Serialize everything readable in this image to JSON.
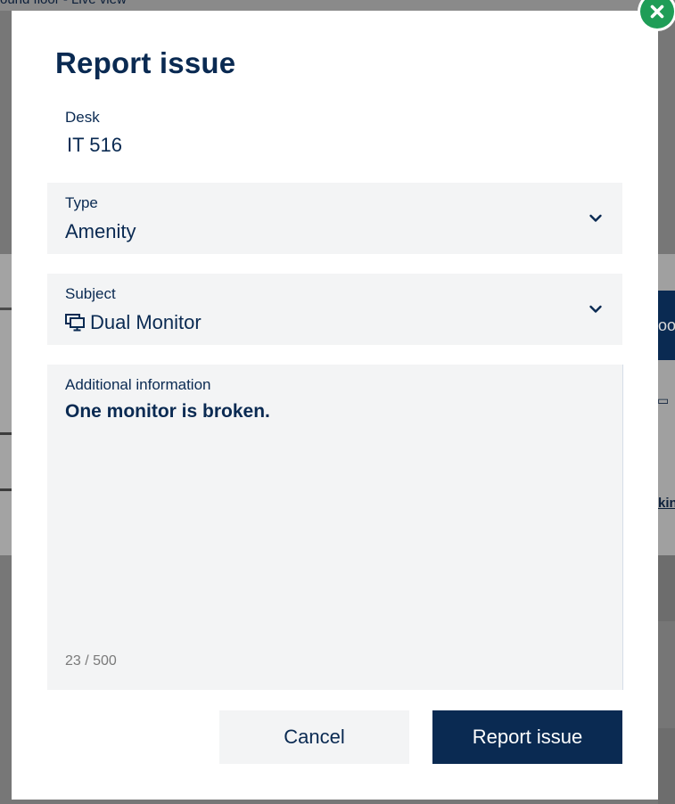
{
  "background": {
    "page_title": "ound floor - Live view",
    "right_button_text": "oo",
    "right_link_text": "kin"
  },
  "modal": {
    "title": "Report issue",
    "close_icon": "close-icon",
    "desk": {
      "label": "Desk",
      "value": "IT 516"
    },
    "type": {
      "label": "Type",
      "value": "Amenity",
      "icon": "chevron-down-icon"
    },
    "subject": {
      "label": "Subject",
      "value": "Dual Monitor",
      "value_icon": "dual-monitor-icon",
      "icon": "chevron-down-icon"
    },
    "additional_info": {
      "label": "Additional information",
      "value": "One monitor is broken.",
      "counter": "23 / 500"
    },
    "cancel_label": "Cancel",
    "submit_label": "Report issue"
  },
  "colors": {
    "primary": "#0a2a52",
    "field_background": "#f3f4f5",
    "close_badge": "#1f9d57",
    "overlay": "#777777"
  }
}
